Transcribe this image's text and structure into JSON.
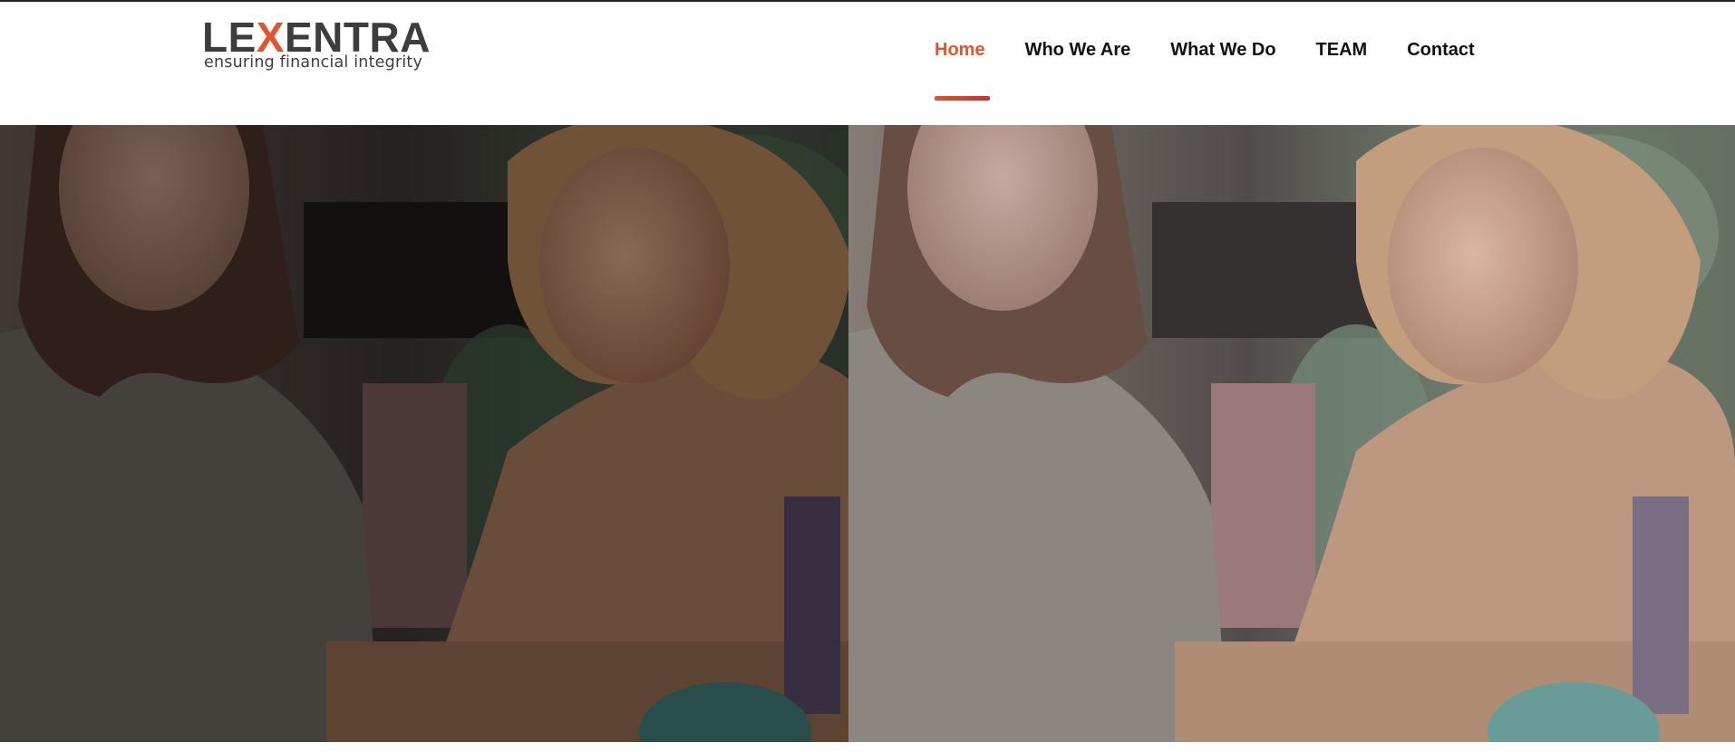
{
  "brand": {
    "logo_prefix": "LE",
    "logo_accent": "X",
    "logo_suffix": "ENTRA",
    "tagline": "ensuring financial integrity",
    "text_color": "#3d3d3d",
    "accent_color": "#e2542d"
  },
  "nav": {
    "items": [
      {
        "label": "Home",
        "active": true
      },
      {
        "label": "Who We Are",
        "active": false
      },
      {
        "label": "What We Do",
        "active": false
      },
      {
        "label": "TEAM",
        "active": false
      },
      {
        "label": "Contact",
        "active": false
      }
    ],
    "active_color": "#e2542d",
    "text_color": "#111111"
  },
  "hero": {
    "image_subject": "two-women-reviewing-documents-photo"
  }
}
